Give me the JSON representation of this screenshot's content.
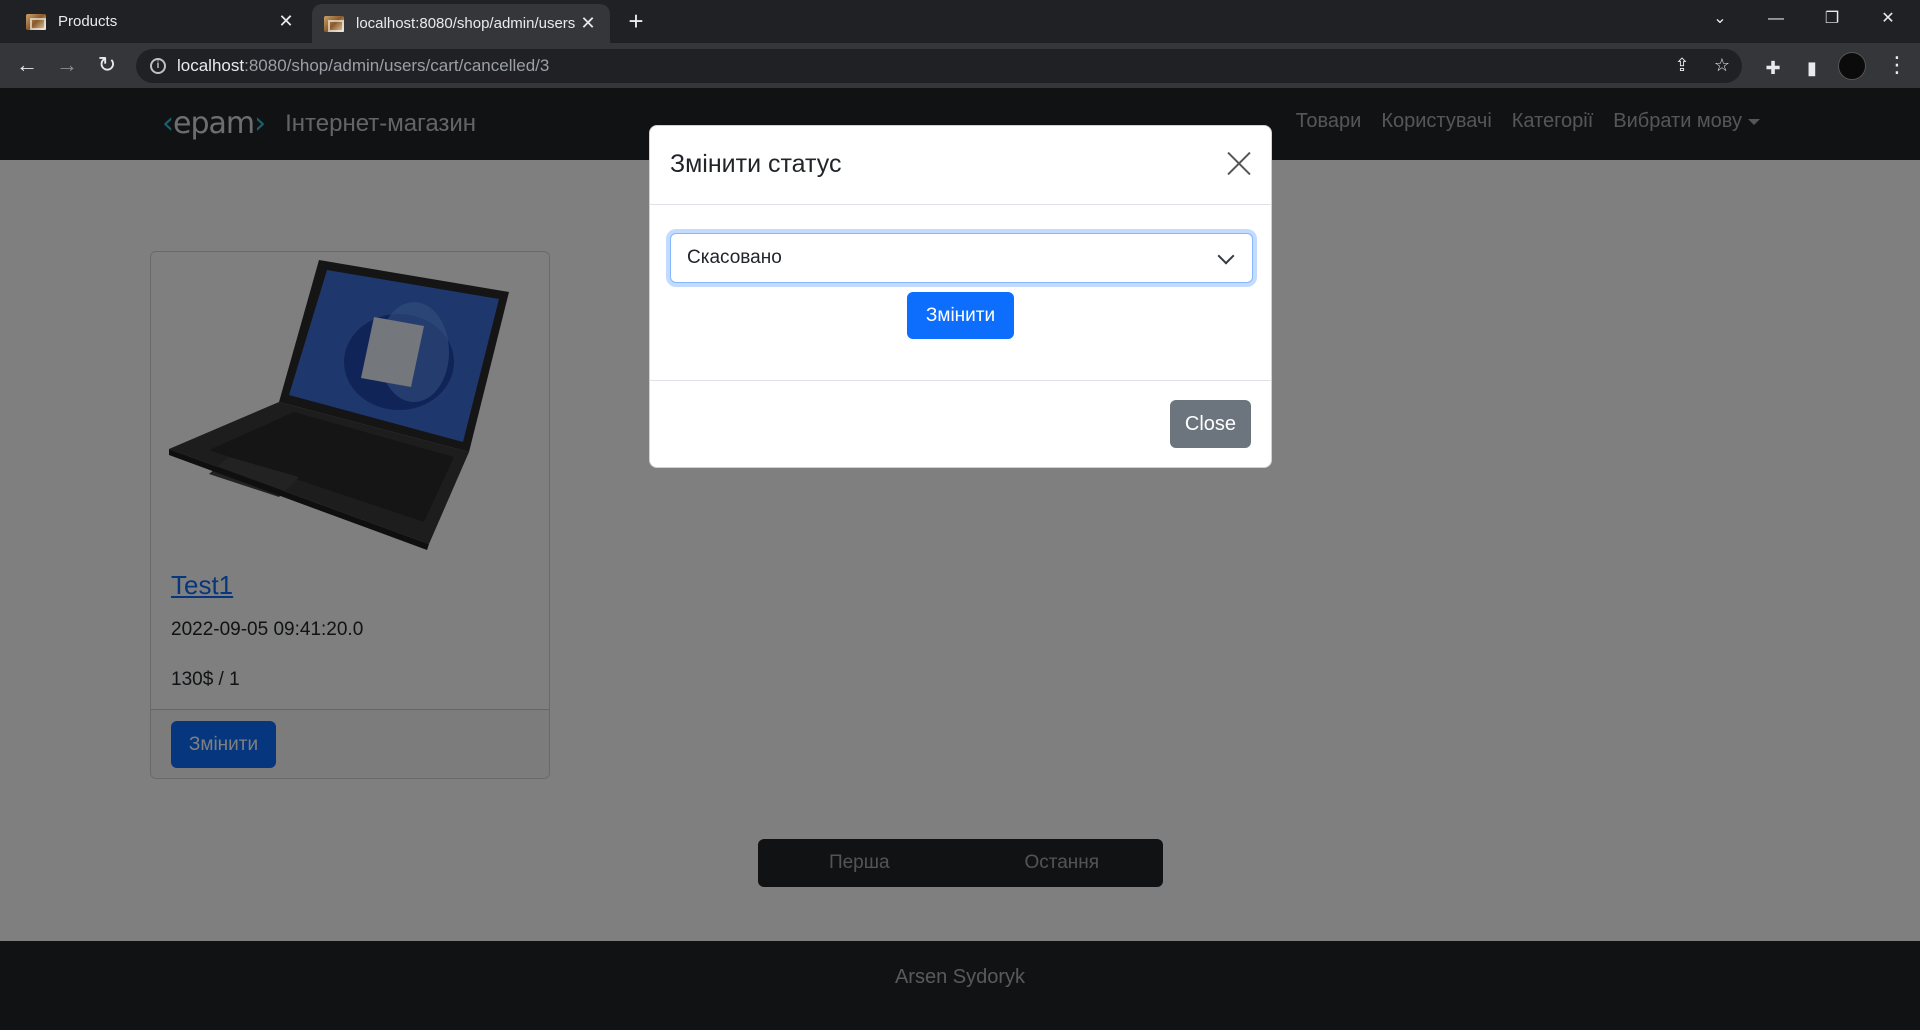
{
  "browser": {
    "tabs": [
      {
        "title": "Products",
        "active": false
      },
      {
        "title": "localhost:8080/shop/admin/users",
        "active": true
      }
    ],
    "url_host": "localhost",
    "url_path": ":8080/shop/admin/users/cart/cancelled/3"
  },
  "site": {
    "logo": {
      "left": "‹",
      "name": "epam",
      "right": "›"
    },
    "brand_text": "Інтернет-магазин",
    "nav": {
      "products": "Товари",
      "users": "Користувачі",
      "categories": "Категорії",
      "language": "Вибрати мову"
    }
  },
  "card": {
    "title": "Test1",
    "date": "2022-09-05 09:41:20.0",
    "price": "130$ / 1",
    "button": "Змінити"
  },
  "pagination": {
    "first": "Перша",
    "last": "Остання"
  },
  "footer": {
    "author": "Arsen Sydoryk"
  },
  "modal": {
    "title": "Змінити статус",
    "selected_status": "Скасовано",
    "submit_label": "Змінити",
    "close_label": "Close"
  },
  "colors": {
    "primary": "#0d6efd",
    "secondary": "#6c757d",
    "dark": "#212529",
    "logo_accent": "#39c2d7"
  }
}
